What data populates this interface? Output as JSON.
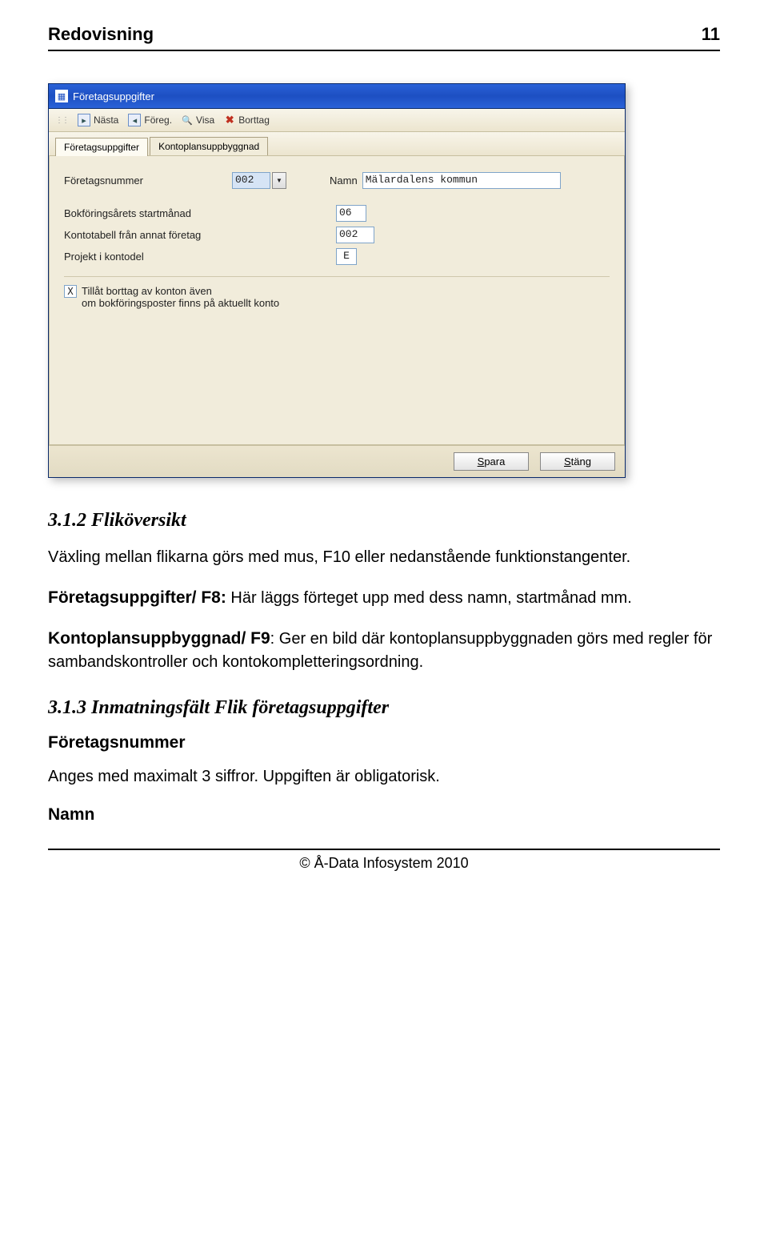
{
  "header": {
    "left": "Redovisning",
    "right": "11"
  },
  "window": {
    "title": "Företagsuppgifter",
    "toolbar": {
      "next": "Nästa",
      "prev": "Föreg.",
      "show": "Visa",
      "delete": "Borttag"
    },
    "tabs": {
      "tab1": "Företagsuppgifter",
      "tab2": "Kontoplansuppbyggnad"
    },
    "form": {
      "company_number_label": "Företagsnummer",
      "company_number_value": "002",
      "name_label": "Namn",
      "name_value": "Mälardalens kommun",
      "start_month_label": "Bokföringsårets startmånad",
      "start_month_value": "06",
      "other_company_label": "Kontotabell från annat företag",
      "other_company_value": "002",
      "project_label": "Projekt i kontodel",
      "project_value": "E",
      "allow_delete_line1": "Tillåt borttag av konton även",
      "allow_delete_line2": "om bokföringsposter finns på aktuellt konto",
      "allow_delete_checked": "X"
    },
    "buttons": {
      "save_firstletter": "S",
      "save_rest": "para",
      "close_firstletter": "S",
      "close_rest": "täng"
    }
  },
  "text": {
    "h1": "3.1.2 Fliköversikt",
    "p1": "Växling mellan flikarna görs med mus, F10 eller nedanstående funktionstangenter.",
    "p2_lead": "Företagsuppgifter/ F8:",
    "p2_rest": " Här läggs förteget upp med dess namn, startmånad mm.",
    "p3_lead": "Kontoplansuppbyggnad/ F9",
    "p3_rest": ":  Ger en bild där kontoplansuppbyggnaden görs med regler för sambandskontroller och kontokompletteringsordning.",
    "h2": "3.1.3 Inmatningsfält Flik företagsuppgifter",
    "sub1": "Företagsnummer",
    "p4": "Anges med maximalt 3 siffror. Uppgiften är obligatorisk.",
    "sub2": "Namn"
  },
  "footer": "© Å-Data Infosystem 2010"
}
